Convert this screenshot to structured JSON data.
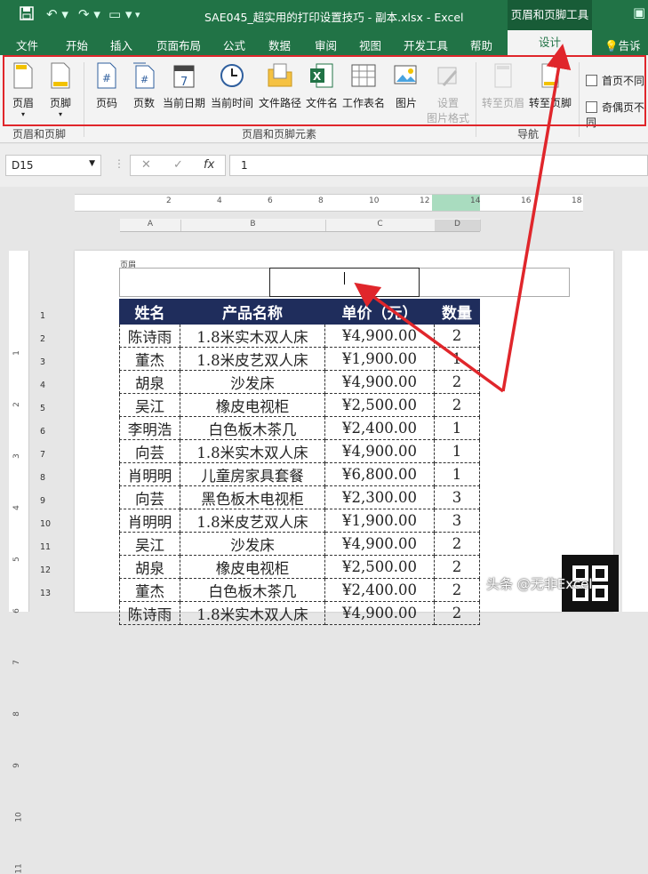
{
  "titlebar": {
    "title": "SAE045_超实用的打印设置技巧 - 副本.xlsx  -  Excel",
    "contextual": "页眉和页脚工具"
  },
  "tabs": [
    "文件",
    "开始",
    "插入",
    "页面布局",
    "公式",
    "数据",
    "审阅",
    "视图",
    "开发工具",
    "帮助"
  ],
  "active_tab": "设计",
  "tell_me": "告诉我",
  "ribbon": {
    "group1": {
      "label": "页眉和页脚",
      "buttons": [
        "页眉",
        "页脚"
      ]
    },
    "group2": {
      "label": "页眉和页脚元素",
      "buttons": [
        "页码",
        "页数",
        "当前日期",
        "当前时间",
        "文件路径",
        "文件名",
        "工作表名",
        "图片"
      ],
      "format_picture": [
        "设置",
        "图片格式"
      ]
    },
    "group3": {
      "label": "导航",
      "buttons": [
        "转至页眉",
        "转至页脚"
      ]
    },
    "options": [
      "首页不同",
      "奇偶页不同"
    ]
  },
  "formula_bar": {
    "name_box": "D15",
    "value": "1",
    "fx": "fx"
  },
  "ruler": {
    "marks": [
      "2",
      "4",
      "6",
      "8",
      "10",
      "12",
      "14",
      "16",
      "18"
    ]
  },
  "column_headers": [
    "A",
    "B",
    "C",
    "D"
  ],
  "page": {
    "header_label": "页眉",
    "table": {
      "headers": [
        "姓名",
        "产品名称",
        "单价（元）",
        "数量"
      ],
      "rows": [
        [
          "陈诗雨",
          "1.8米实木双人床",
          "¥4,900.00",
          "2"
        ],
        [
          "董杰",
          "1.8米皮艺双人床",
          "¥1,900.00",
          "1"
        ],
        [
          "胡泉",
          "沙发床",
          "¥4,900.00",
          "2"
        ],
        [
          "吴江",
          "橡皮电视柜",
          "¥2,500.00",
          "2"
        ],
        [
          "李明浩",
          "白色板木茶几",
          "¥2,400.00",
          "1"
        ],
        [
          "向芸",
          "1.8米实木双人床",
          "¥4,900.00",
          "1"
        ],
        [
          "肖明明",
          "儿童房家具套餐",
          "¥6,800.00",
          "1"
        ],
        [
          "向芸",
          "黑色板木电视柜",
          "¥2,300.00",
          "3"
        ],
        [
          "肖明明",
          "1.8米皮艺双人床",
          "¥1,900.00",
          "3"
        ],
        [
          "吴江",
          "沙发床",
          "¥4,900.00",
          "2"
        ],
        [
          "胡泉",
          "橡皮电视柜",
          "¥2,500.00",
          "2"
        ],
        [
          "董杰",
          "白色板木茶几",
          "¥2,400.00",
          "2"
        ],
        [
          "陈诗雨",
          "1.8米实木双人床",
          "¥4,900.00",
          "2"
        ]
      ]
    },
    "row_numbers": [
      "1",
      "2",
      "3",
      "4",
      "5",
      "6",
      "7",
      "8",
      "9",
      "10",
      "11",
      "12",
      "13"
    ],
    "vruler_marks": [
      "1",
      "2",
      "3",
      "4",
      "5",
      "6",
      "7",
      "8",
      "9",
      "10",
      "11"
    ]
  },
  "watermark": "头条 @无非Excel",
  "colors": {
    "excel_green": "#217346",
    "table_header": "#1f2d5c",
    "highlight": "#e0262b"
  }
}
